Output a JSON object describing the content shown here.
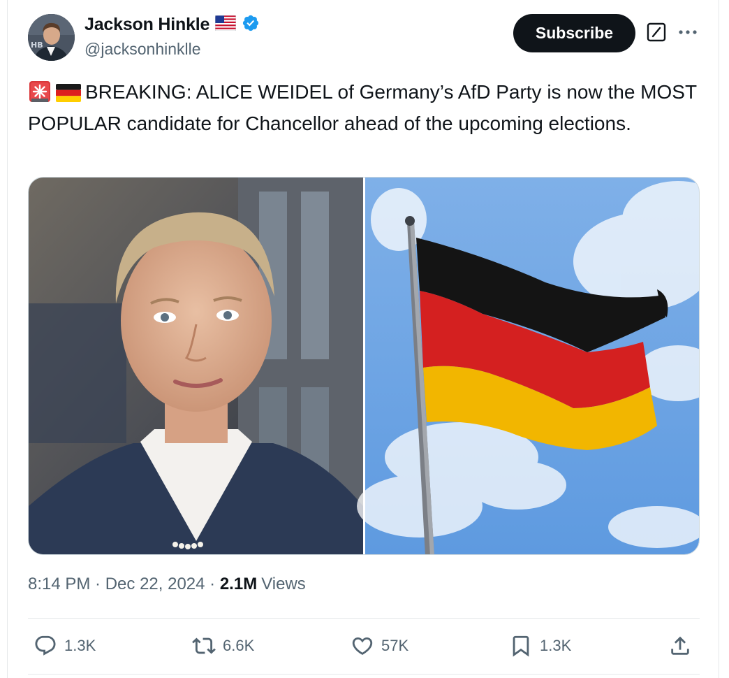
{
  "author": {
    "display_name": "Jackson Hinkle",
    "flag_icon": "us-flag-icon",
    "verified_icon": "verified-badge-icon",
    "handle": "@jacksonhinklle",
    "avatar_badge": "HB"
  },
  "header_actions": {
    "subscribe_label": "Subscribe",
    "grok_icon": "grok-icon",
    "more_icon": "more-icon"
  },
  "tweet": {
    "emoji_1": "siren-icon",
    "emoji_2": "germany-flag-icon",
    "text": "BREAKING: ALICE WEIDEL of Germany’s AfD Party is now the MOST POPULAR candidate for Chancellor ahead of the upcoming elections."
  },
  "media": {
    "images": [
      "portrait-photo",
      "german-flag-photo"
    ]
  },
  "meta": {
    "time": "8:14 PM",
    "sep1": " · ",
    "date": "Dec 22, 2024",
    "sep2": " · ",
    "views_count": "2.1M",
    "views_label": "Views"
  },
  "actions": {
    "reply_count": "1.3K",
    "retweet_count": "6.6K",
    "like_count": "57K",
    "bookmark_count": "1.3K"
  },
  "colors": {
    "text": "#0f1419",
    "secondary": "#536471",
    "verified": "#1d9bf0",
    "divider": "#e6e8ea"
  }
}
